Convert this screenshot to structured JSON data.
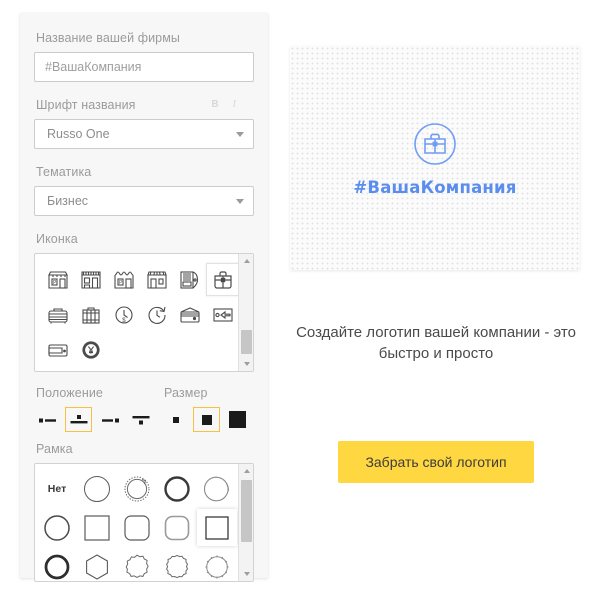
{
  "editor": {
    "company_name": {
      "label": "Название вашей фирмы",
      "value": "#ВашаКомпания"
    },
    "font": {
      "label": "Шрифт названия",
      "selected": "Russo One",
      "bold_label": "B",
      "italic_label": "I"
    },
    "theme": {
      "label": "Тематика",
      "selected": "Бизнес"
    },
    "icon": {
      "label": "Иконка",
      "selected_index": 5,
      "items": [
        "shop-awning-icon",
        "shop-storefront-icon",
        "shop-parking-icon",
        "shop-market-icon",
        "vending-machine-icon",
        "briefcase-icon",
        "suitcase-icon",
        "trunk-case-icon",
        "clock-money-icon",
        "stopwatch-icon",
        "wallet-icon",
        "money-exchange-icon",
        "card-wallet-icon",
        "yen-clock-icon"
      ]
    },
    "position": {
      "label": "Положение",
      "selected_index": 1,
      "options": [
        "icon-left",
        "icon-top",
        "icon-right",
        "icon-bottom"
      ]
    },
    "size": {
      "label": "Размер",
      "selected_index": 1,
      "options": [
        "size-small",
        "size-medium",
        "size-large"
      ]
    },
    "frame": {
      "label": "Рамка",
      "none_label": "Нет",
      "selected_index": 9,
      "options": [
        "frame-none",
        "circle-thin",
        "circle-dashed-arrow",
        "circle-bold",
        "circle-sketch",
        "circle-medium",
        "square-sharp",
        "square-rounded",
        "square-soft",
        "square-shadow",
        "circle-thick",
        "hexagon",
        "scallop-12",
        "scallop-14",
        "gear-circle"
      ]
    }
  },
  "preview": {
    "logo_text": "#ВашаКомпания",
    "logo_icon": "briefcase-circle-icon",
    "accent_color": "#5a8dee"
  },
  "cta": {
    "tagline": "Создайте логотип вашей компании - это быстро и просто",
    "button_label": "Забрать свой логотип",
    "button_color": "#ffd740"
  }
}
